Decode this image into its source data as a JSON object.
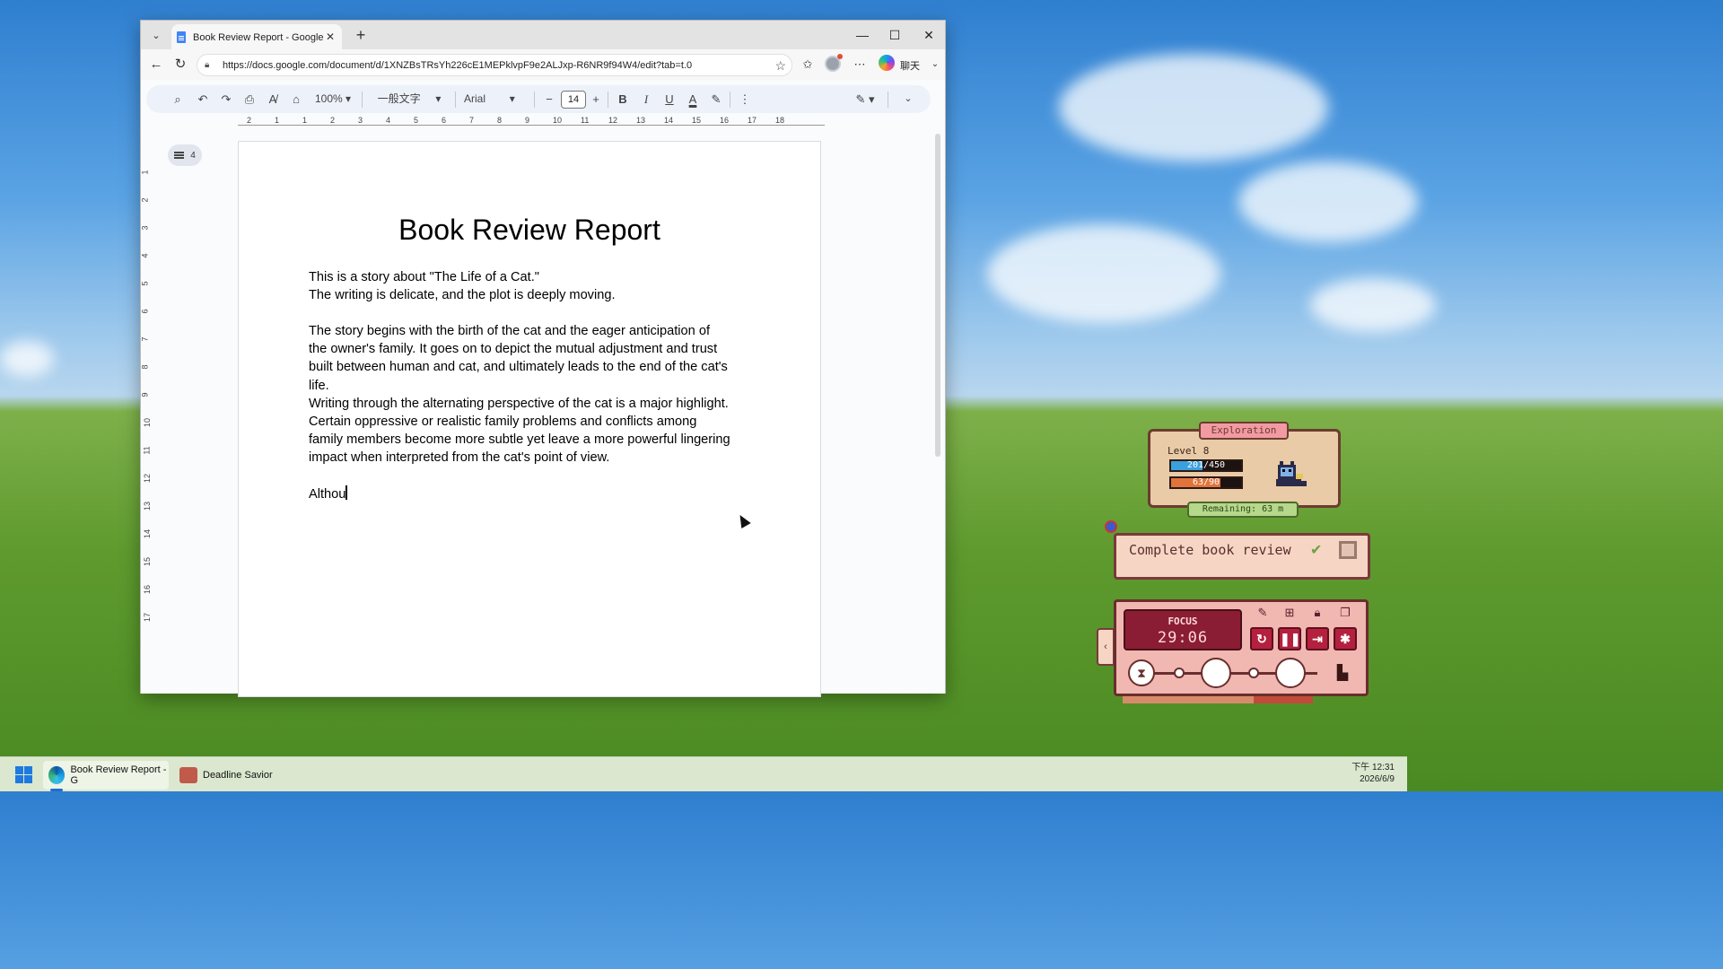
{
  "browser": {
    "tab_title": "Book Review Report - Google 文件",
    "url": "https://docs.google.com/document/d/1XNZBsTRsYh226cE1MEPklvpF9e2ALJxp-R6NR9f94W4/edit?tab=t.0",
    "chat_label": "聊天"
  },
  "docs_toolbar": {
    "zoom": "100%",
    "style": "一般文字",
    "font": "Arial",
    "font_size": "14"
  },
  "ruler": {
    "h_ticks": [
      "2",
      "1",
      "1",
      "2",
      "3",
      "4",
      "5",
      "6",
      "7",
      "8",
      "9",
      "10",
      "11",
      "12",
      "13",
      "14",
      "15",
      "16",
      "17",
      "18"
    ],
    "v_ticks": [
      "1",
      "2",
      "3",
      "4",
      "5",
      "6",
      "7",
      "8",
      "9",
      "10",
      "11",
      "12",
      "13",
      "14",
      "15",
      "16",
      "17"
    ]
  },
  "outline": {
    "count": "4"
  },
  "document": {
    "title": "Book Review Report",
    "para1_line1": "This is a story about \"The Life of a Cat.\"",
    "para1_line2": "The writing is delicate, and the plot is deeply moving.",
    "para2": [
      "The story begins with the birth of the cat and the eager anticipation of",
      "the owner's family. It goes on to depict the mutual adjustment and trust",
      "built between human and cat, and ultimately leads to the end of the cat's",
      "life.",
      "Writing through the alternating perspective of the cat is a major highlight.",
      "Certain oppressive or realistic family problems and conflicts among",
      "family members become more subtle yet leave a more powerful lingering",
      "impact when interpreted from the cat's point of view."
    ],
    "typing": "Althou"
  },
  "widget": {
    "mode": "Exploration",
    "level": "Level 8",
    "xp": "201/450",
    "xp_fraction": 0.447,
    "energy": "63/90",
    "energy_fraction": 0.7,
    "remaining": "Remaining: 63 m",
    "task": "Complete book review",
    "focus_label": "FOCUS",
    "focus_time": "29:06",
    "colors": {
      "xp_bar": "#3aa0e0",
      "energy_bar": "#e0743a",
      "focus_bg": "#8a1d33"
    }
  },
  "taskbar": {
    "items": [
      {
        "label": "Book Review Report - G",
        "icon": "edge-icon"
      },
      {
        "label": "Deadline Savior",
        "icon": "deadline-savior-icon"
      }
    ],
    "time": "下午 12:31",
    "date": "2026/6/9"
  }
}
